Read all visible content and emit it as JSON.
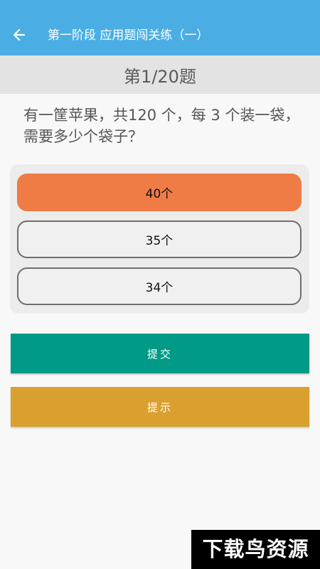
{
  "header": {
    "title": "第一阶段  应用题闯关练（一）",
    "back_icon": "arrow-left-icon"
  },
  "progress": {
    "text": "第1/20题"
  },
  "question": {
    "text": "有一筐苹果，共120 个，每 3 个装一袋，需要多少个袋子？"
  },
  "options": [
    {
      "label": "40个",
      "selected": true
    },
    {
      "label": "35个",
      "selected": false
    },
    {
      "label": "34个",
      "selected": false
    }
  ],
  "actions": {
    "submit_label": "提交",
    "hint_label": "提示"
  },
  "watermark": {
    "text": "下载鸟资源"
  },
  "colors": {
    "header_bg": "#4aaee4",
    "selected_option": "#ef7b45",
    "submit_button": "#009a86",
    "hint_button": "#daa02f"
  }
}
